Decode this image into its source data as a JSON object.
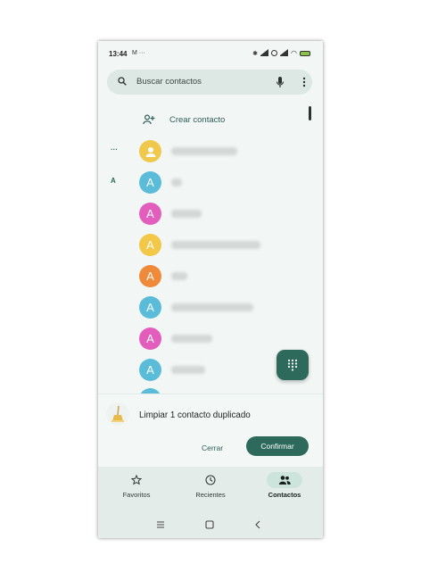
{
  "status": {
    "time": "13:44",
    "extra": "M ···",
    "battery": "100"
  },
  "search": {
    "placeholder": "Buscar contactos"
  },
  "list": {
    "create_label": "Crear contacto",
    "rows": [
      {
        "section": "···",
        "avatar_letter": "",
        "avatar_color": "#f0c94c",
        "is_person_icon": true
      },
      {
        "section": "A",
        "avatar_letter": "A",
        "avatar_color": "#5bbcd9"
      },
      {
        "section": "",
        "avatar_letter": "A",
        "avatar_color": "#e25dbc"
      },
      {
        "section": "",
        "avatar_letter": "A",
        "avatar_color": "#f3c747"
      },
      {
        "section": "",
        "avatar_letter": "A",
        "avatar_color": "#ee8a3a"
      },
      {
        "section": "",
        "avatar_letter": "A",
        "avatar_color": "#5bbcd9"
      },
      {
        "section": "",
        "avatar_letter": "A",
        "avatar_color": "#e25dbc"
      },
      {
        "section": "",
        "avatar_letter": "A",
        "avatar_color": "#5bbcd9"
      }
    ]
  },
  "cleanup": {
    "message": "Limpiar 1 contacto duplicado",
    "cancel_label": "Cerrar",
    "confirm_label": "Confirmar"
  },
  "nav": {
    "items": [
      {
        "label": "Favoritos",
        "icon": "star-icon",
        "active": false
      },
      {
        "label": "Recientes",
        "icon": "clock-icon",
        "active": false
      },
      {
        "label": "Contactos",
        "icon": "people-icon",
        "active": true
      }
    ]
  },
  "colors": {
    "accent": "#2e6a5c",
    "background": "#f2f6f4"
  }
}
